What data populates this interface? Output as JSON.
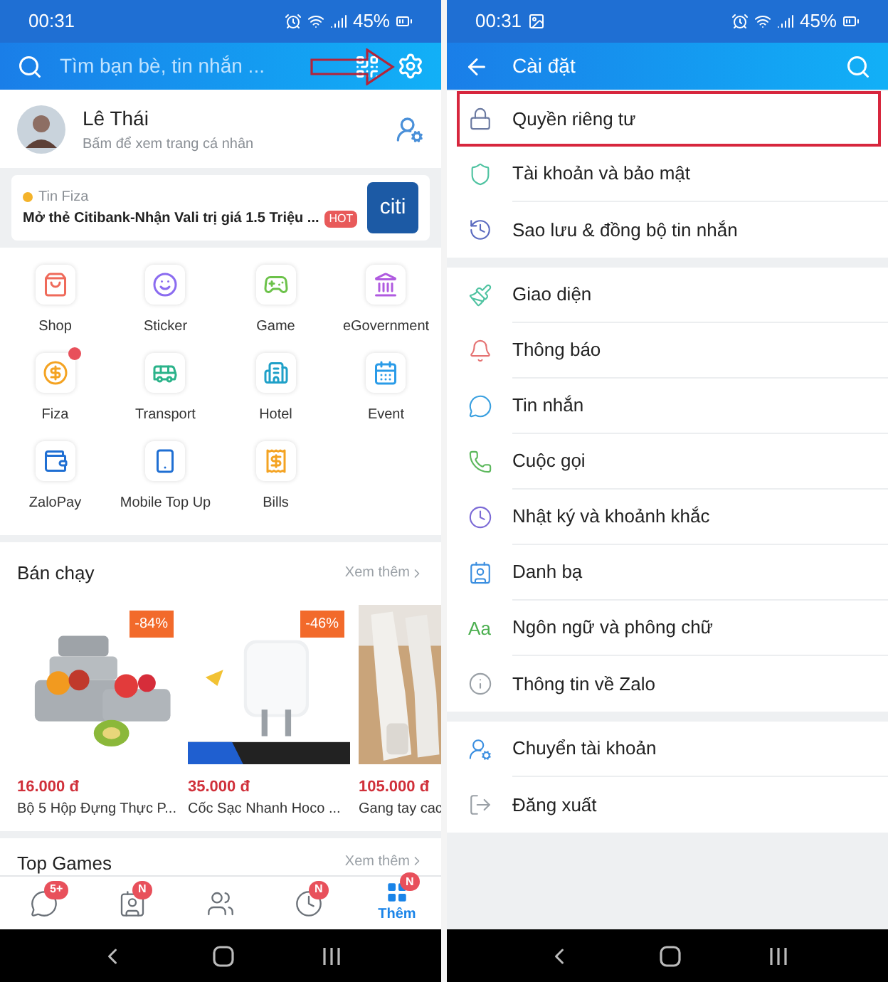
{
  "left_screen": {
    "status_bar": {
      "time": "00:31",
      "battery": "45%"
    },
    "search": {
      "placeholder": "Tìm bạn bè, tin nhắn ..."
    },
    "profile": {
      "name": "Lê Thái",
      "subtitle": "Bấm để xem trang cá nhân"
    },
    "news": {
      "source": "Tin Fiza",
      "headline": "Mở thẻ Citibank-Nhận Vali trị giá 1.5 Triệu ...",
      "badge": "HOT",
      "logo_text": "citi"
    },
    "apps": [
      {
        "label": "Shop",
        "dot": false
      },
      {
        "label": "Sticker",
        "dot": false
      },
      {
        "label": "Game",
        "dot": false
      },
      {
        "label": "eGovernment",
        "dot": false
      },
      {
        "label": "Fiza",
        "dot": true
      },
      {
        "label": "Transport",
        "dot": false
      },
      {
        "label": "Hotel",
        "dot": false
      },
      {
        "label": "Event",
        "dot": false
      },
      {
        "label": "ZaloPay",
        "dot": false
      },
      {
        "label": "Mobile Top Up",
        "dot": false
      },
      {
        "label": "Bills",
        "dot": false
      }
    ],
    "best_sellers": {
      "title": "Bán chạy",
      "more": "Xem thêm",
      "products": [
        {
          "kind": "picture",
          "discount": "-84%",
          "price": "16.000 đ",
          "name": "Bộ 5 Hộp Đựng Thực P..."
        },
        {
          "kind": "picture",
          "discount": "-46%",
          "price": "35.000 đ",
          "name": "Cốc Sạc Nhanh Hoco ..."
        },
        {
          "kind": "picture",
          "price": "105.000 đ",
          "name": "Gang tay cac"
        }
      ]
    },
    "top_games": {
      "title": "Top Games",
      "more": "Xem thêm"
    },
    "tabs": [
      {
        "badge": "5+",
        "selected": false
      },
      {
        "badge": "N",
        "selected": false
      },
      {
        "selected": false
      },
      {
        "badge": "N",
        "selected": false
      },
      {
        "label": "Thêm",
        "badge": "N",
        "selected": true
      }
    ]
  },
  "right_screen": {
    "status_bar": {
      "time": "00:31",
      "battery": "45%"
    },
    "title": "Cài đặt",
    "groups": [
      {
        "items": [
          {
            "label": "Quyền riêng tư",
            "highlighted": true
          },
          {
            "label": "Tài khoản và bảo mật",
            "highlighted": false
          },
          {
            "label": "Sao lưu & đồng bộ tin nhắn",
            "highlighted": false
          }
        ]
      },
      {
        "items": [
          {
            "label": "Giao diện",
            "highlighted": false
          },
          {
            "label": "Thông báo",
            "highlighted": false
          },
          {
            "label": "Tin nhắn",
            "highlighted": false
          },
          {
            "label": "Cuộc gọi",
            "highlighted": false
          },
          {
            "label": "Nhật ký và khoảnh khắc",
            "highlighted": false
          },
          {
            "label": "Danh bạ",
            "highlighted": false
          },
          {
            "label": "Ngôn ngữ và phông chữ",
            "highlighted": false,
            "icon_text": "Aa"
          },
          {
            "label": "Thông tin về Zalo",
            "highlighted": false
          }
        ]
      },
      {
        "items": [
          {
            "label": "Chuyển tài khoản",
            "highlighted": false
          },
          {
            "label": "Đăng xuất",
            "highlighted": false
          }
        ]
      }
    ]
  }
}
